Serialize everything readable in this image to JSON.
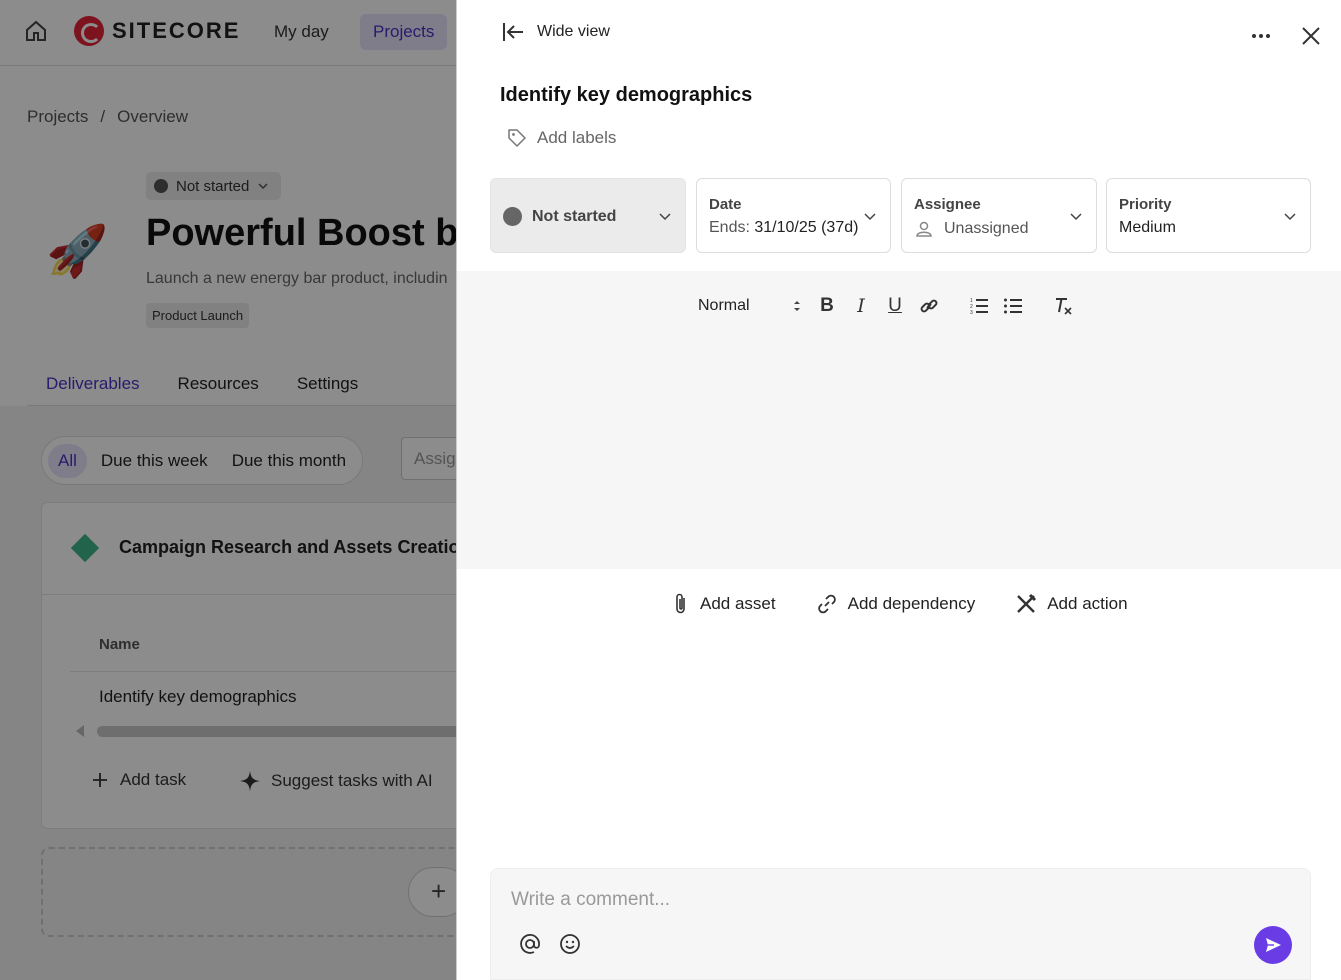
{
  "app": {
    "brand": "SITECORE",
    "nav": [
      {
        "label": "My day",
        "active": false
      },
      {
        "label": "Projects",
        "active": true
      }
    ],
    "accent_color": "#4a33c6"
  },
  "breadcrumb": {
    "items": [
      "Projects",
      "Overview"
    ],
    "separator": "/"
  },
  "project": {
    "status": "Not started",
    "title": "Powerful Boost bar",
    "description": "Launch a new energy bar product, includin",
    "tag": "Product Launch"
  },
  "tabs": [
    {
      "label": "Deliverables",
      "active": true
    },
    {
      "label": "Resources",
      "active": false
    },
    {
      "label": "Settings",
      "active": false
    }
  ],
  "filters": {
    "items": [
      {
        "label": "All",
        "active": true
      },
      {
        "label": "Due this week",
        "active": false
      },
      {
        "label": "Due this month",
        "active": false
      }
    ],
    "assignee_placeholder": "Assig"
  },
  "deliverable": {
    "title": "Campaign Research and Assets Creatio",
    "column_name": "Name",
    "rows": [
      "Identify key demographics"
    ],
    "add_task": "Add task",
    "suggest": "Suggest tasks with AI"
  },
  "panel": {
    "wide_view": "Wide view",
    "task_title": "Identify key demographics",
    "add_labels": "Add labels",
    "status": "Not started",
    "date": {
      "label": "Date",
      "prefix": "Ends:",
      "value": "31/10/25 (37d)"
    },
    "assignee": {
      "label": "Assignee",
      "value": "Unassigned"
    },
    "priority": {
      "label": "Priority",
      "value": "Medium"
    },
    "editor": {
      "format": "Normal",
      "tools": [
        "bold",
        "italic",
        "underline",
        "link",
        "ordered-list",
        "bullet-list",
        "clear-format"
      ]
    },
    "actions": {
      "add_asset": "Add asset",
      "add_dependency": "Add dependency",
      "add_action": "Add action"
    },
    "comment": {
      "placeholder": "Write a comment..."
    },
    "send_color": "#6a3ce6"
  }
}
